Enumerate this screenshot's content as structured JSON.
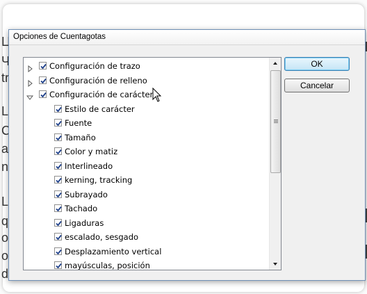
{
  "dialog": {
    "title": "Opciones de Cuentagotas",
    "buttons": {
      "ok": "OK",
      "cancel": "Cancelar"
    }
  },
  "tree": {
    "items": [
      {
        "label": "Configuración de trazo",
        "level": 0,
        "expander": "collapsed",
        "checked": true
      },
      {
        "label": "Configuración de relleno",
        "level": 0,
        "expander": "collapsed",
        "checked": true
      },
      {
        "label": "Configuración de carácter",
        "level": 0,
        "expander": "expanded",
        "checked": true
      },
      {
        "label": "Estilo de carácter",
        "level": 1,
        "checked": true
      },
      {
        "label": "Fuente",
        "level": 1,
        "checked": true
      },
      {
        "label": "Tamaño",
        "level": 1,
        "checked": true
      },
      {
        "label": "Color y matiz",
        "level": 1,
        "checked": true
      },
      {
        "label": "Interlineado",
        "level": 1,
        "checked": true
      },
      {
        "label": "kerning, tracking",
        "level": 1,
        "checked": true
      },
      {
        "label": "Subrayado",
        "level": 1,
        "checked": true
      },
      {
        "label": "Tachado",
        "level": 1,
        "checked": true
      },
      {
        "label": "Ligaduras",
        "level": 1,
        "checked": true
      },
      {
        "label": "escalado, sesgado",
        "level": 1,
        "checked": true
      },
      {
        "label": "Desplazamiento vertical",
        "level": 1,
        "checked": true
      },
      {
        "label": "mayúsculas, posición",
        "level": 1,
        "checked": true
      }
    ]
  },
  "background": {
    "left_glyphs": [
      "Ц",
      "Ч",
      "tr",
      "L",
      "С",
      "a",
      "n",
      "L",
      "q",
      "o",
      "o",
      "d"
    ]
  }
}
